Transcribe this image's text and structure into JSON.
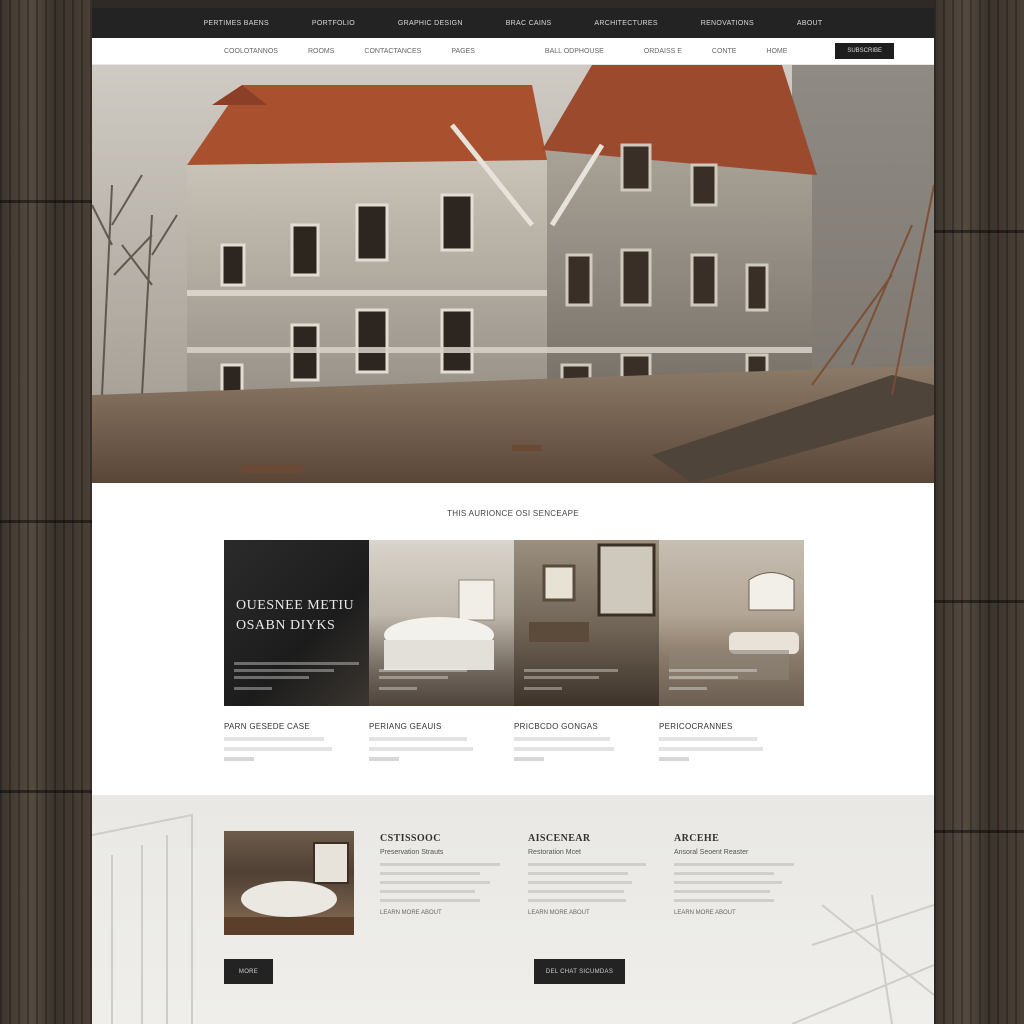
{
  "top_nav": [
    "PERTIMES BAENS",
    "PORTFOLIO",
    "GRAPHIC DESIGN",
    "BRAC CAINS",
    "ARCHITECTURES",
    "RENOVATIONS",
    "ABOUT"
  ],
  "sub_nav": [
    "COOLOTANNOS",
    "ROOMS",
    "CONTACTANCES",
    "PAGES",
    "BALL ODPHOUSE",
    "ORDAISS E",
    "CONTE",
    "HOME"
  ],
  "sub_nav_button": "SUBSCRIBE",
  "section_title": "THIS AURIONCE OSI SENCEAPE",
  "rooms": {
    "feature_title_line1": "OUESNEE METIU",
    "feature_title_line2": "OSABN DIYKS",
    "captions": [
      {
        "title": "PARN GESEDE CASE"
      },
      {
        "title": "PERIANG GEAUIS"
      },
      {
        "title": "PRICBCDO GONGAS"
      },
      {
        "title": "PERICOCRANNES"
      }
    ]
  },
  "bottom": {
    "columns": [
      {
        "title": "CSTISSOOC",
        "subtitle": "Preservation Strauts",
        "link": "LEARN MORE ABOUT"
      },
      {
        "title": "AISCENEAR",
        "subtitle": "Restoration Mcet",
        "link": "LEARN MORE ABOUT"
      },
      {
        "title": "ARCEHE",
        "subtitle": "Ansoral Seoent Reaster",
        "link": "LEARN MORE ABOUT"
      }
    ],
    "left_button": "MORE",
    "center_button": "DEL CHAT SICUMDAS"
  },
  "colors": {
    "nav_dark": "#232323",
    "panel_light": "#ecebe7",
    "roof": "#a9502f"
  }
}
